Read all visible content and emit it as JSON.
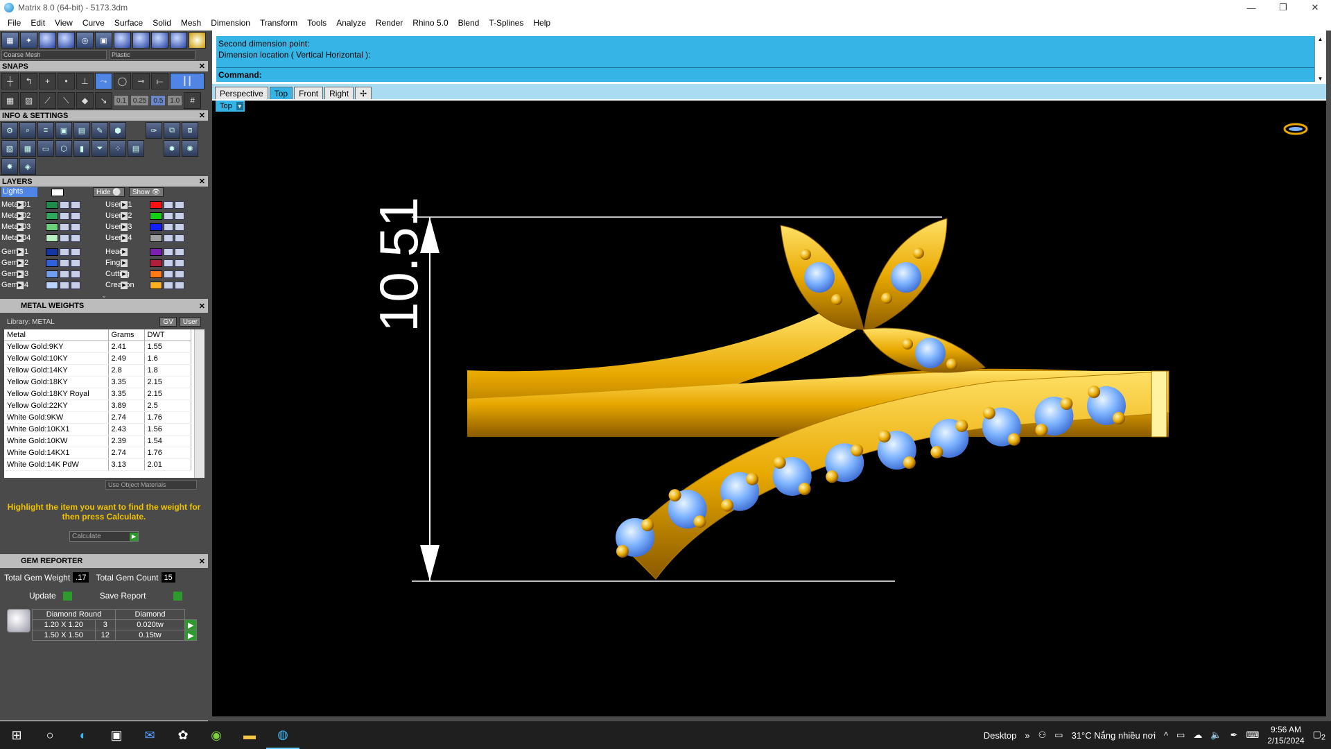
{
  "window": {
    "title": "Matrix 8.0 (64-bit) - 5173.3dm",
    "minimize": "—",
    "restore": "❐",
    "close": "✕"
  },
  "menu": [
    "File",
    "Edit",
    "View",
    "Curve",
    "Surface",
    "Solid",
    "Mesh",
    "Dimension",
    "Transform",
    "Tools",
    "Analyze",
    "Render",
    "Rhino 5.0",
    "Blend",
    "T-Splines",
    "Help"
  ],
  "toolbar": {
    "mesh_combo": "Coarse Mesh",
    "material_combo": "Plastic"
  },
  "snaps": {
    "title": "SNAPS",
    "values": [
      "0.1",
      "0.25",
      "0.5",
      "1.0"
    ]
  },
  "info": {
    "title": "INFO & SETTINGS"
  },
  "layers": {
    "title": "LAYERS",
    "lights_label": "Lights",
    "hide_label": "Hide",
    "show_label": "Show",
    "left": [
      {
        "name": "Metal 01",
        "color": "#1f8a4a"
      },
      {
        "name": "Metal 02",
        "color": "#2ea85a"
      },
      {
        "name": "Metal 03",
        "color": "#6ad37a"
      },
      {
        "name": "Metal 04",
        "color": "#b8efc0"
      },
      {
        "name": "Gem 01",
        "color": "#1336a0"
      },
      {
        "name": "Gem 02",
        "color": "#2f62d8"
      },
      {
        "name": "Gem 03",
        "color": "#6fa0f0"
      },
      {
        "name": "Gem 04",
        "color": "#b8d4ff"
      }
    ],
    "right": [
      {
        "name": "User 01",
        "color": "#ff1010"
      },
      {
        "name": "User 02",
        "color": "#10d010"
      },
      {
        "name": "User 03",
        "color": "#1020ff"
      },
      {
        "name": "User 04",
        "color": "#a0a0a0"
      },
      {
        "name": "Heads",
        "color": "#7a1fb0"
      },
      {
        "name": "Finger",
        "color": "#b01f3a"
      },
      {
        "name": "Cutting",
        "color": "#ff7a10"
      },
      {
        "name": "Creation",
        "color": "#ffb020"
      }
    ]
  },
  "metal_weights": {
    "title": "METAL WEIGHTS",
    "library": "Library: METAL",
    "gv": "GV",
    "user": "User",
    "columns": [
      "Metal",
      "Grams",
      "DWT"
    ],
    "rows": [
      [
        "Yellow Gold:9KY",
        "2.41",
        "1.55"
      ],
      [
        "Yellow Gold:10KY",
        "2.49",
        "1.6"
      ],
      [
        "Yellow Gold:14KY",
        "2.8",
        "1.8"
      ],
      [
        "Yellow Gold:18KY",
        "3.35",
        "2.15"
      ],
      [
        "Yellow Gold:18KY Royal",
        "3.35",
        "2.15"
      ],
      [
        "Yellow Gold:22KY",
        "3.89",
        "2.5"
      ],
      [
        "White Gold:9KW",
        "2.74",
        "1.76"
      ],
      [
        "White Gold:10KX1",
        "2.43",
        "1.56"
      ],
      [
        "White Gold:10KW",
        "2.39",
        "1.54"
      ],
      [
        "White Gold:14KX1",
        "2.74",
        "1.76"
      ],
      [
        "White Gold:14K PdW",
        "3.13",
        "2.01"
      ]
    ],
    "use_object_materials": "Use Object Materials",
    "hint": "Highlight the item you want to find the weight for then press Calculate.",
    "calculate": "Calculate"
  },
  "gem_reporter": {
    "title": "GEM REPORTER",
    "total_weight_label": "Total Gem Weight",
    "total_weight": ".17",
    "total_count_label": "Total Gem Count",
    "total_count": "15",
    "update": "Update",
    "save_report": "Save Report",
    "columns": [
      "Diamond Round",
      "Diamond"
    ],
    "rows": [
      [
        "1.20 X 1.20",
        "3",
        "0.020tw"
      ],
      [
        "1.50 X 1.50",
        "12",
        "0.15tw"
      ]
    ]
  },
  "command": {
    "history": [
      "Second dimension point:",
      "Dimension location ( Vertical  Horizontal ):"
    ],
    "prompt": "Command:"
  },
  "viewport_tabs": [
    "Perspective",
    "Top",
    "Front",
    "Right"
  ],
  "viewport": {
    "active_label": "Top",
    "dimension": "10.51"
  },
  "taskbar": {
    "desktop": "Desktop",
    "weather": "31°C  Nắng nhiều nơi",
    "time": "9:56 AM",
    "date": "2/15/2024",
    "notifications": "2"
  },
  "colors": {
    "command_bg": "#35b5e5",
    "gold": "#e8b000",
    "gem": "#7fb4ff",
    "panel": "#4a4a4a"
  }
}
